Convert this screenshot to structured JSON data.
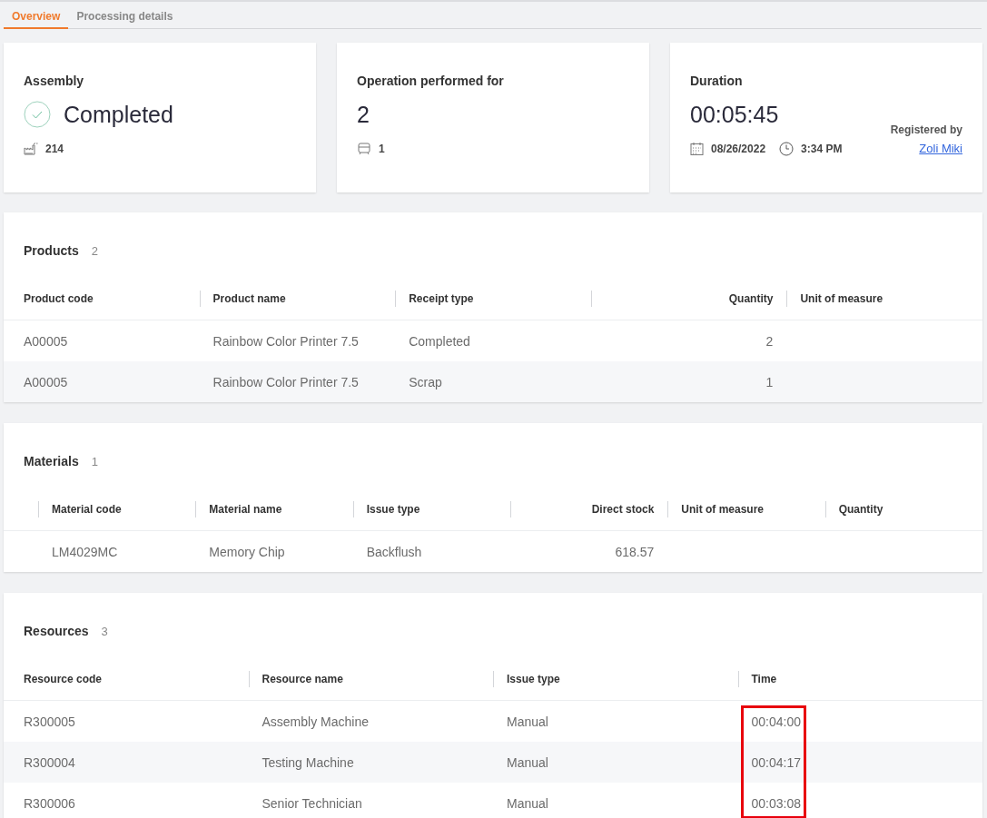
{
  "tabs": [
    {
      "label": "Overview",
      "selected": true
    },
    {
      "label": "Processing details",
      "selected": false
    }
  ],
  "summary": {
    "assembly": {
      "title": "Assembly",
      "status": "Completed",
      "completed": true,
      "count": "214"
    },
    "operation": {
      "title": "Operation performed for",
      "value": "2",
      "count": "1"
    },
    "duration": {
      "title": "Duration",
      "value": "00:05:45",
      "date": "08/26/2022",
      "time": "3:34 PM",
      "registered_label": "Registered by",
      "registered_by": "Zoli Miki"
    }
  },
  "sections": [
    {
      "title": "Products",
      "count": "2",
      "lead_column": false,
      "columns": [
        {
          "label": "Product code",
          "kind": "text",
          "highlighted": false
        },
        {
          "label": "Product name",
          "kind": "text",
          "highlighted": false
        },
        {
          "label": "Receipt type",
          "kind": "text",
          "highlighted": false
        },
        {
          "label": "Quantity",
          "kind": "number",
          "highlighted": false
        },
        {
          "label": "Unit of measure",
          "kind": "text",
          "highlighted": false
        }
      ],
      "rows": [
        [
          "A00005",
          "Rainbow Color Printer 7.5",
          "Completed",
          "2",
          ""
        ],
        [
          "A00005",
          "Rainbow Color Printer 7.5",
          "Scrap",
          "1",
          ""
        ]
      ]
    },
    {
      "title": "Materials",
      "count": "1",
      "lead_column": true,
      "columns": [
        {
          "label": "Material code",
          "kind": "text",
          "highlighted": false
        },
        {
          "label": "Material name",
          "kind": "text",
          "highlighted": false
        },
        {
          "label": "Issue type",
          "kind": "text",
          "highlighted": false
        },
        {
          "label": "Direct stock",
          "kind": "number",
          "highlighted": false
        },
        {
          "label": "Unit of measure",
          "kind": "text",
          "highlighted": false
        },
        {
          "label": "Quantity",
          "kind": "text",
          "highlighted": false
        }
      ],
      "rows": [
        [
          "LM4029MC",
          "Memory Chip",
          "Backflush",
          "618.57",
          "",
          ""
        ]
      ]
    },
    {
      "title": "Resources",
      "count": "3",
      "lead_column": false,
      "columns": [
        {
          "label": "Resource code",
          "kind": "text",
          "highlighted": false
        },
        {
          "label": "Resource name",
          "kind": "text",
          "highlighted": false
        },
        {
          "label": "Issue type",
          "kind": "text",
          "highlighted": false
        },
        {
          "label": "Time",
          "kind": "text",
          "highlighted": true
        }
      ],
      "rows": [
        [
          "R300005",
          "Assembly Machine",
          "Manual",
          "00:04:00"
        ],
        [
          "R300004",
          "Testing Machine",
          "Manual",
          "00:04:17"
        ],
        [
          "R300006",
          "Senior Technician",
          "Manual",
          "00:03:08"
        ]
      ]
    }
  ]
}
